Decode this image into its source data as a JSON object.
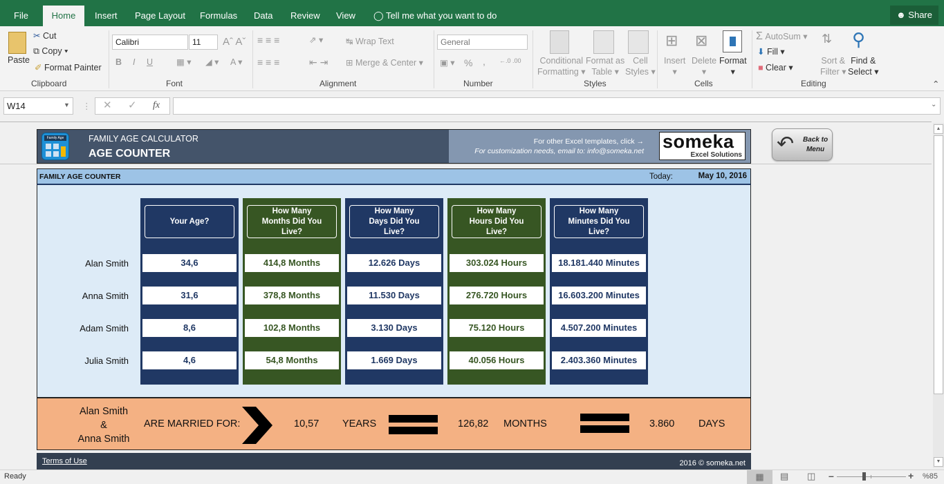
{
  "tabs": {
    "file": "File",
    "home": "Home",
    "insert": "Insert",
    "page_layout": "Page Layout",
    "formulas": "Formulas",
    "data": "Data",
    "review": "Review",
    "view": "View",
    "tell_me": "Tell me what you want to do",
    "share": "Share"
  },
  "ribbon": {
    "clipboard": {
      "label": "Clipboard",
      "paste": "Paste",
      "cut": "Cut",
      "copy": "Copy",
      "format_painter": "Format Painter"
    },
    "font": {
      "label": "Font",
      "font_name": "Calibri",
      "font_size": "11",
      "bold": "B",
      "italic": "I",
      "underline": "U"
    },
    "alignment": {
      "label": "Alignment",
      "wrap_text": "Wrap Text",
      "merge_center": "Merge & Center"
    },
    "number": {
      "label": "Number",
      "format": "General",
      "percent": "%",
      "comma": ","
    },
    "styles": {
      "label": "Styles",
      "conditional": "Conditional",
      "formatting": "Formatting",
      "format_as": "Format as",
      "table": "Table",
      "cell": "Cell",
      "styles": "Styles"
    },
    "cells": {
      "label": "Cells",
      "insert": "Insert",
      "delete": "Delete",
      "format": "Format"
    },
    "editing": {
      "label": "Editing",
      "autosum": "AutoSum",
      "fill": "Fill",
      "clear": "Clear",
      "sort": "Sort &",
      "filter": "Filter",
      "find": "Find &",
      "select": "Select"
    }
  },
  "formula_bar": {
    "name_box": "W14",
    "fx": "fx",
    "formula": ""
  },
  "header": {
    "app_title": "FAMILY AGE CALCULATOR",
    "subtitle": "AGE COUNTER",
    "logo_label": "Family Age",
    "templates_text": "For other Excel templates, click →",
    "custom_text": "For customization needs, email to: info@someka.net",
    "brand": "someka",
    "brand_sub": "Excel Solutions",
    "back_button": "Back to Menu"
  },
  "panel": {
    "title": "FAMILY AGE COUNTER",
    "today_label": "Today:",
    "today_value": "May 10, 2016"
  },
  "columns": [
    {
      "header": "Your Age?",
      "color": "blue",
      "values": [
        "34,6",
        "31,6",
        "8,6",
        "4,6"
      ]
    },
    {
      "header": "How Many Months Did You Live?",
      "color": "green",
      "values": [
        "414,8 Months",
        "378,8 Months",
        "102,8 Months",
        "54,8 Months"
      ]
    },
    {
      "header": "How Many Days Did You Live?",
      "color": "blue",
      "values": [
        "12.626 Days",
        "11.530 Days",
        "3.130 Days",
        "1.669 Days"
      ]
    },
    {
      "header": "How Many Hours Did You Live?",
      "color": "green",
      "values": [
        "303.024 Hours",
        "276.720 Hours",
        "75.120 Hours",
        "40.056 Hours"
      ]
    },
    {
      "header": "How Many Minutes Did You Live?",
      "color": "blue",
      "values": [
        "18.181.440 Minutes",
        "16.603.200 Minutes",
        "4.507.200 Minutes",
        "2.403.360 Minutes"
      ]
    }
  ],
  "people": [
    "Alan Smith",
    "Anna Smith",
    "Adam Smith",
    "Julia Smith"
  ],
  "marriage": {
    "person1": "Alan Smith",
    "amp": "&",
    "person2": "Anna Smith",
    "label": "ARE MARRIED FOR:",
    "years": "10,57",
    "years_unit": "YEARS",
    "months": "126,82",
    "months_unit": "MONTHS",
    "days": "3.860",
    "days_unit": "DAYS"
  },
  "footer": {
    "terms": "Terms of Use",
    "copyright": "2016 © someka.net"
  },
  "status": {
    "ready": "Ready",
    "zoom": "%85",
    "zoom_level_percent": 85
  }
}
